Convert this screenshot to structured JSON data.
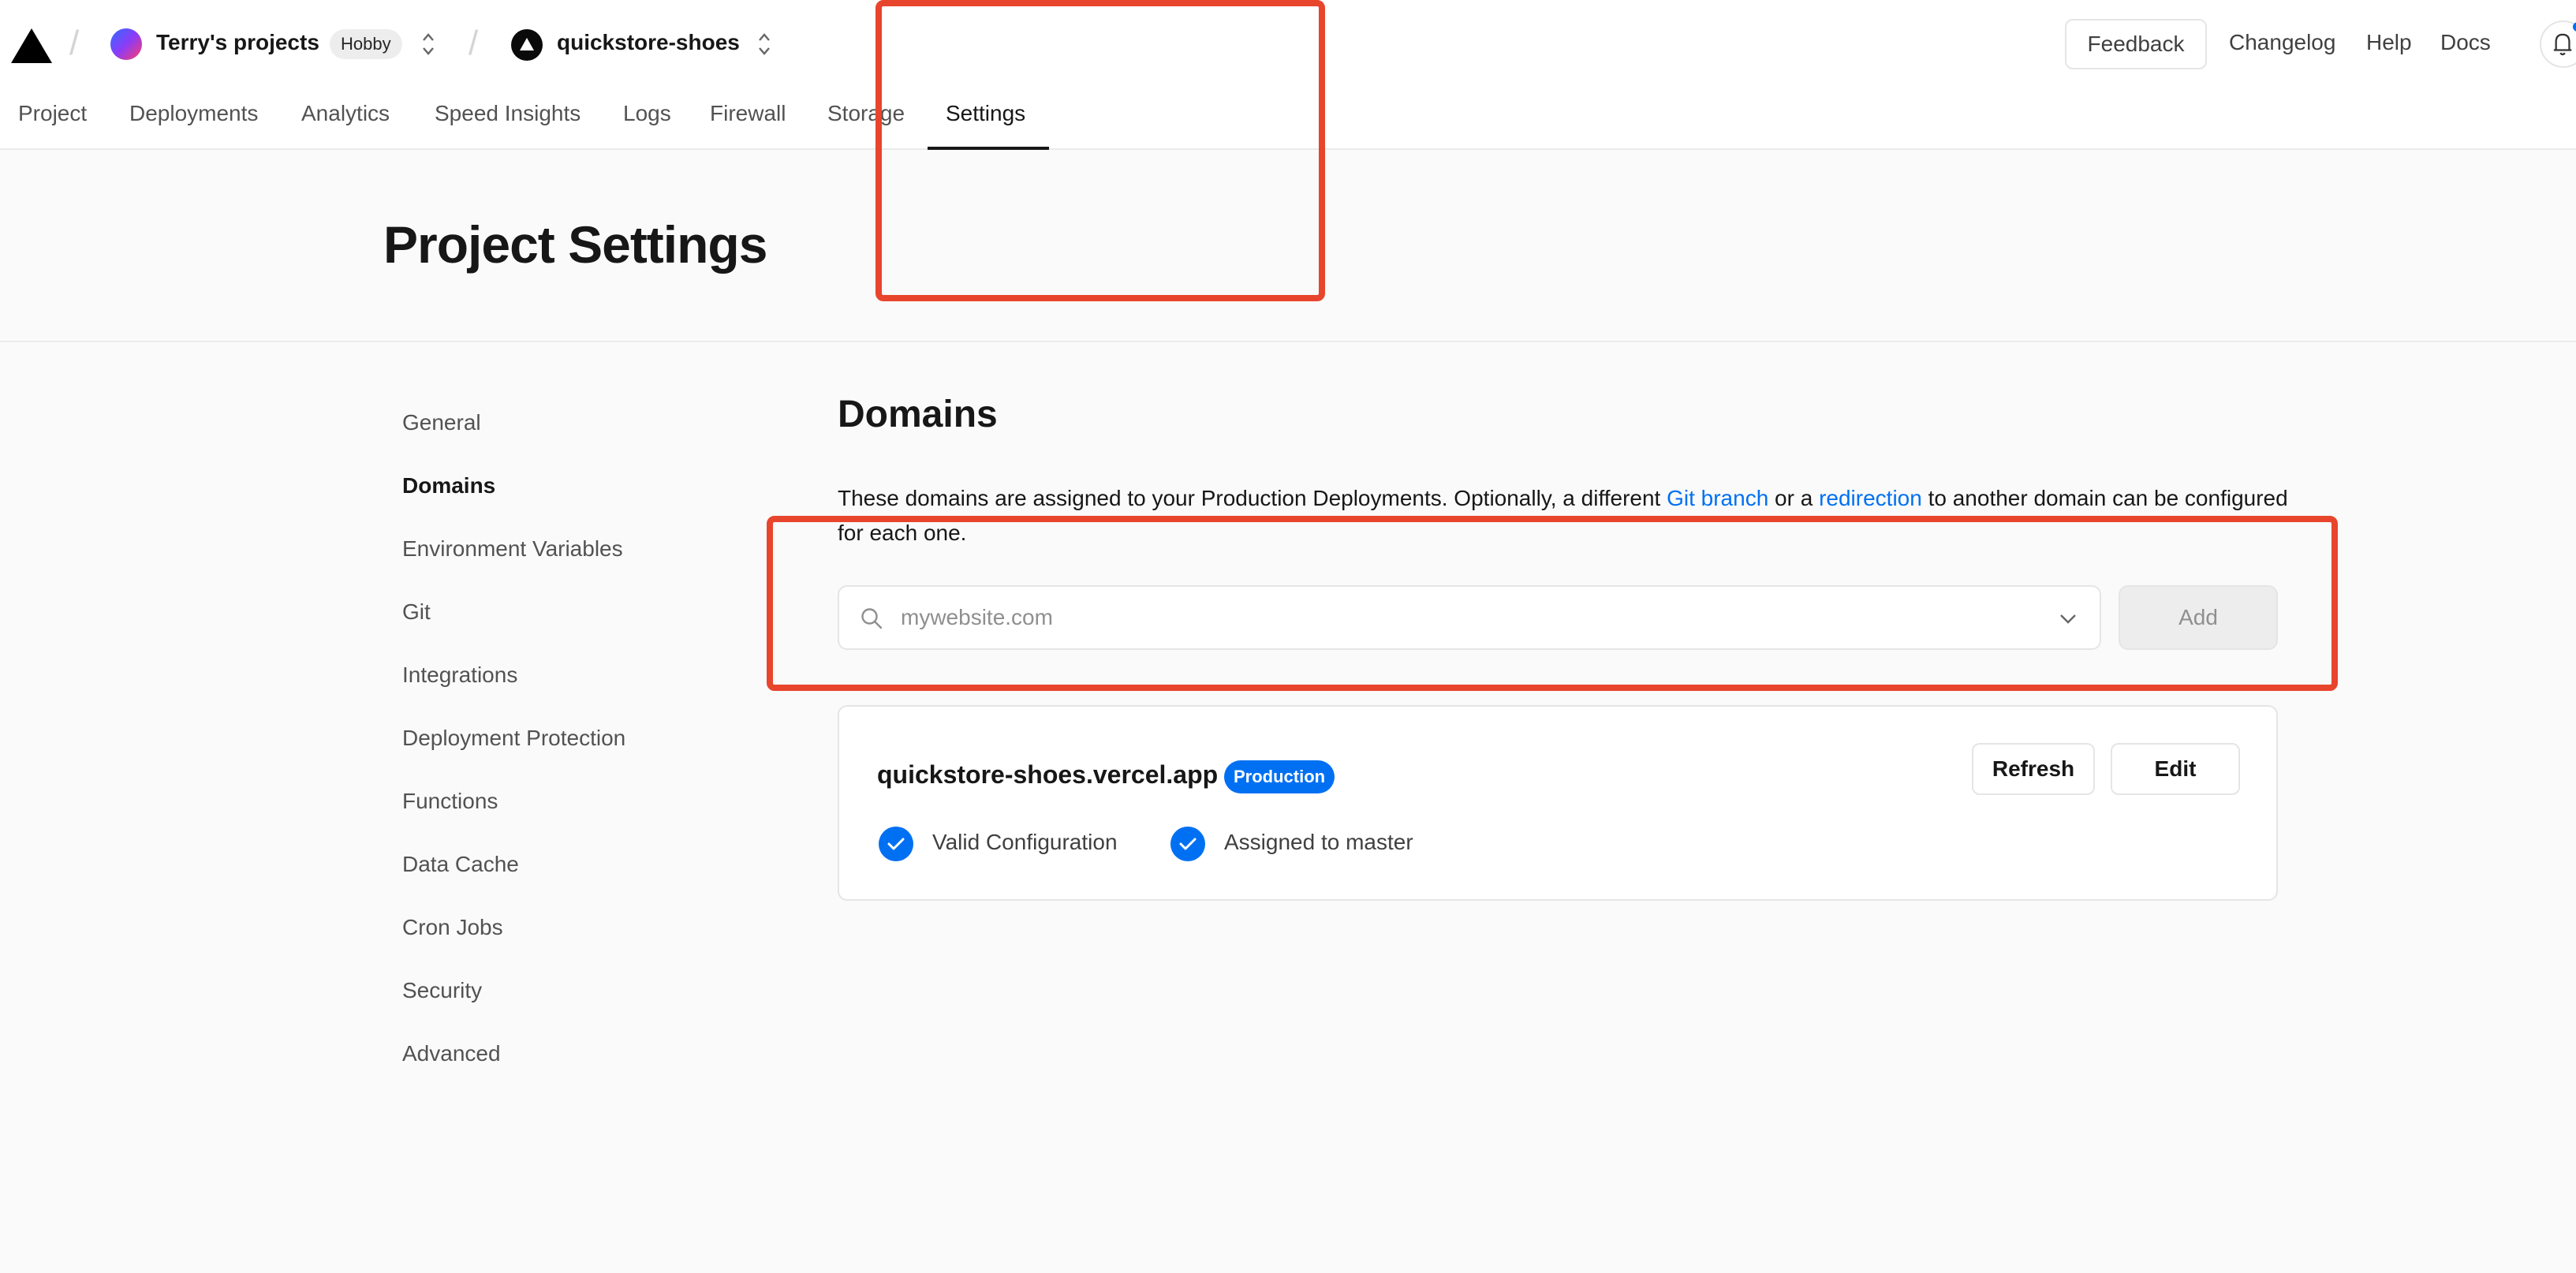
{
  "topbar": {
    "team_name": "Terry's projects",
    "plan_badge": "Hobby",
    "project_name": "quickstore-shoes",
    "feedback_label": "Feedback",
    "links": [
      "Changelog",
      "Help",
      "Docs"
    ]
  },
  "tabs": [
    {
      "label": "Project"
    },
    {
      "label": "Deployments"
    },
    {
      "label": "Analytics"
    },
    {
      "label": "Speed Insights"
    },
    {
      "label": "Logs"
    },
    {
      "label": "Firewall"
    },
    {
      "label": "Storage"
    },
    {
      "label": "Settings",
      "active": true
    }
  ],
  "page": {
    "title": "Project Settings"
  },
  "sidebar": {
    "items": [
      {
        "label": "General"
      },
      {
        "label": "Domains",
        "active": true
      },
      {
        "label": "Environment Variables"
      },
      {
        "label": "Git"
      },
      {
        "label": "Integrations"
      },
      {
        "label": "Deployment Protection"
      },
      {
        "label": "Functions"
      },
      {
        "label": "Data Cache"
      },
      {
        "label": "Cron Jobs"
      },
      {
        "label": "Security"
      },
      {
        "label": "Advanced"
      }
    ]
  },
  "domains": {
    "title": "Domains",
    "desc_part1": "These domains are assigned to your Production Deployments. Optionally, a different ",
    "desc_link1": "Git branch",
    "desc_part2": " or a ",
    "desc_link2": "redirection",
    "desc_part3": " to another domain can be configured for each one.",
    "input_placeholder": "mywebsite.com",
    "input_value": "",
    "add_label": "Add"
  },
  "domain_card": {
    "domain": "quickstore-shoes.vercel.app",
    "badge": "Production",
    "refresh_label": "Refresh",
    "edit_label": "Edit",
    "status1": "Valid Configuration",
    "status2": "Assigned to master"
  },
  "colors": {
    "accent": "#0070f3",
    "highlight": "#e8452d"
  }
}
